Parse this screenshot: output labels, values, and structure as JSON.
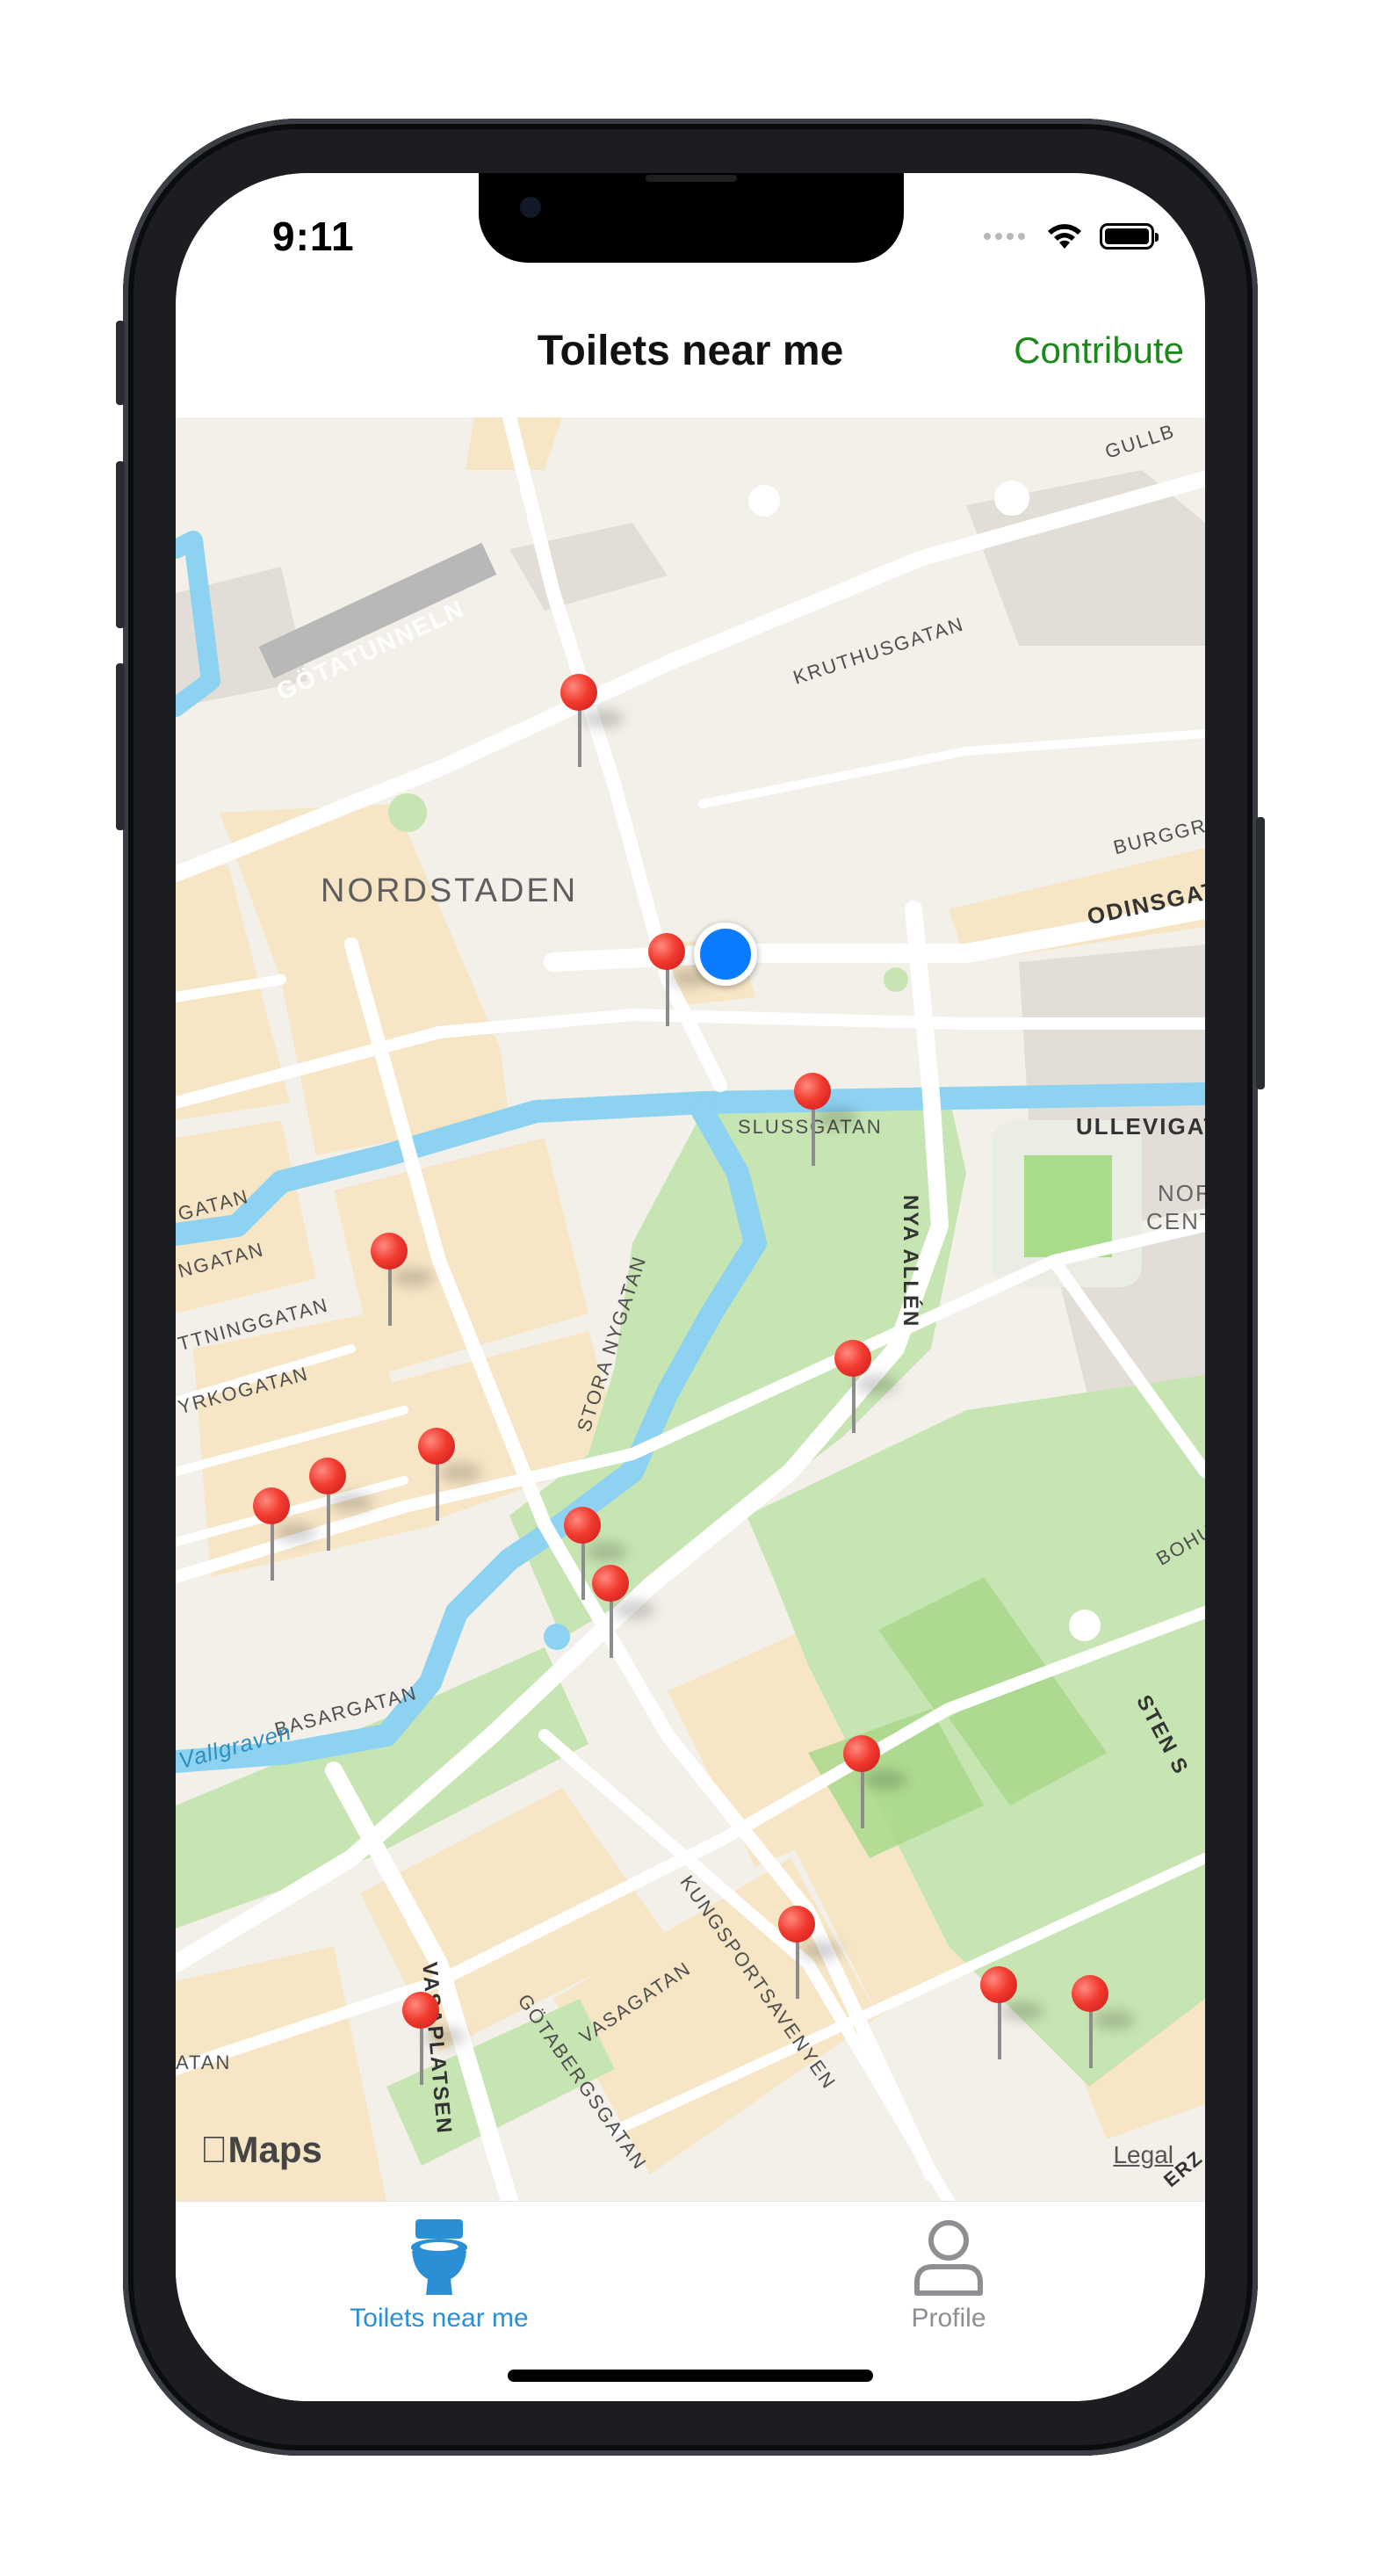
{
  "status_bar": {
    "time": "9:11"
  },
  "nav": {
    "title": "Toilets near me",
    "action": "Contribute"
  },
  "map": {
    "labels": {
      "gotatunneln": "GÖTATUNNELN",
      "kruthusgatan": "KRUTHUSGATAN",
      "gullb": "GULLB",
      "nordstaden": "NORDSTADEN",
      "burggr": "BURGGR",
      "odinsgat": "ODINSGAT",
      "slussgatan": "SLUSSGATAN",
      "ullevigat": "ULLEVIGAT",
      "nor": "NOR",
      "cent": "CENT",
      "nya_allen": "NYA ALLÉN",
      "stora_nygatan": "STORA NYGATAN",
      "gatan_left": "GATAN",
      "ngatan": "NGATAN",
      "ttninggatan": "TTNINGGATAN",
      "yrkogatan": "YRKOGATAN",
      "basargatan": "BASARGATAN",
      "vallgraven": "Vallgraven",
      "bohu": "BOHU",
      "sten": "STEN S",
      "kungsportsavenyen": "KUNGSPORTSAVENYEN",
      "vasagatan": "VASAGATAN",
      "gotabergsgatan": "GÖTABERGSGATAN",
      "vasaplatsen": "VASAPLATSEN",
      "atan": "ATAN",
      "erzi": "ERZ"
    },
    "attribution": {
      "logo": "Maps",
      "legal": "Legal"
    },
    "pin_color": "#f23b2f",
    "user_location_color": "#0a7aff"
  },
  "tabs": [
    {
      "label": "Toilets near me",
      "icon": "toilet-icon",
      "active": true,
      "color": "#2b8fd6"
    },
    {
      "label": "Profile",
      "icon": "person-icon",
      "active": false,
      "color": "#8e8e93"
    }
  ]
}
